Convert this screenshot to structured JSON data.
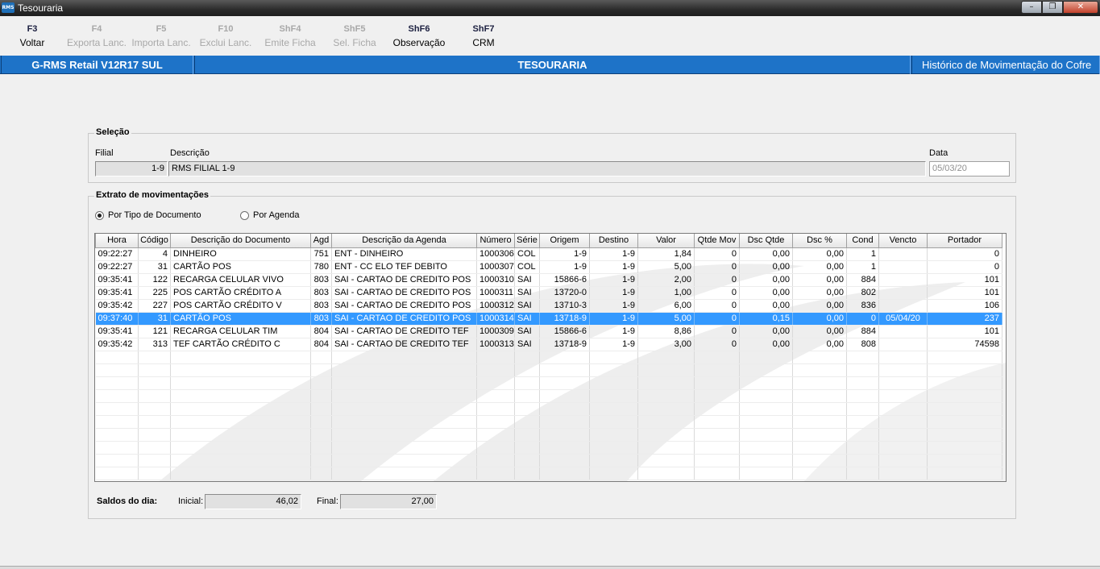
{
  "window": {
    "title": "Tesouraria",
    "app_icon": "RMS"
  },
  "toolbar": [
    {
      "key": "F3",
      "label": "Voltar",
      "enabled": true
    },
    {
      "key": "F4",
      "label": "Exporta Lanc.",
      "enabled": false
    },
    {
      "key": "F5",
      "label": "Importa Lanc.",
      "enabled": false
    },
    {
      "key": "F10",
      "label": "Exclui Lanc.",
      "enabled": false
    },
    {
      "key": "ShF4",
      "label": "Emite Ficha",
      "enabled": false
    },
    {
      "key": "ShF5",
      "label": "Sel. Ficha",
      "enabled": false
    },
    {
      "key": "ShF6",
      "label": "Observação",
      "enabled": true
    },
    {
      "key": "ShF7",
      "label": "CRM",
      "enabled": true
    }
  ],
  "header": {
    "system": "G-RMS Retail V12R17 SUL",
    "module": "TESOURARIA",
    "screen": "Histórico de Movimentação do Cofre"
  },
  "selecao": {
    "legend": "Seleção",
    "filial_label": "Filial",
    "filial_value": "1-9",
    "descricao_label": "Descrição",
    "descricao_value": "RMS FILIAL 1-9",
    "data_label": "Data",
    "data_value": "05/03/20"
  },
  "extrato": {
    "legend": "Extrato de movimentações",
    "radio_tipo": "Por Tipo de Documento",
    "radio_agenda": "Por Agenda",
    "selected_radio": "tipo",
    "columns": [
      "Hora",
      "Código",
      "Descrição do Documento",
      "Agd",
      "Descrição da Agenda",
      "Número",
      "Série",
      "Origem",
      "Destino",
      "Valor",
      "Qtde Mov",
      "Dsc Qtde",
      "Dsc %",
      "Cond",
      "Vencto",
      "Portador"
    ],
    "rows": [
      [
        "09:22:27",
        "4",
        "DINHEIRO",
        "751",
        "ENT - DINHEIRO",
        "1000306",
        "COL",
        "1-9",
        "1-9",
        "1,84",
        "0",
        "0,00",
        "0,00",
        "1",
        "",
        "0"
      ],
      [
        "09:22:27",
        "31",
        "CARTÃO POS",
        "780",
        "ENT - CC ELO TEF DEBITO",
        "1000307",
        "COL",
        "1-9",
        "1-9",
        "5,00",
        "0",
        "0,00",
        "0,00",
        "1",
        "",
        "0"
      ],
      [
        "09:35:41",
        "122",
        "RECARGA CELULAR VIVO",
        "803",
        "SAI - CARTAO DE CREDITO POS",
        "1000310",
        "SAI",
        "15866-6",
        "1-9",
        "2,00",
        "0",
        "0,00",
        "0,00",
        "884",
        "",
        "101"
      ],
      [
        "09:35:41",
        "225",
        "POS CARTÃO CRÉDITO A",
        "803",
        "SAI - CARTAO DE CREDITO POS",
        "1000311",
        "SAI",
        "13720-0",
        "1-9",
        "1,00",
        "0",
        "0,00",
        "0,00",
        "802",
        "",
        "101"
      ],
      [
        "09:35:42",
        "227",
        "POS CARTÃO CRÉDITO V",
        "803",
        "SAI - CARTAO DE CREDITO POS",
        "1000312",
        "SAI",
        "13710-3",
        "1-9",
        "6,00",
        "0",
        "0,00",
        "0,00",
        "836",
        "",
        "106"
      ],
      [
        "09:37:40",
        "31",
        "CARTÃO POS",
        "803",
        "SAI - CARTAO DE CREDITO POS",
        "1000314",
        "SAI",
        "13718-9",
        "1-9",
        "5,00",
        "0",
        "0,15",
        "0,00",
        "0",
        "05/04/20",
        "237"
      ],
      [
        "09:35:41",
        "121",
        "RECARGA CELULAR TIM",
        "804",
        "SAI - CARTAO DE CREDITO TEF",
        "1000309",
        "SAI",
        "15866-6",
        "1-9",
        "8,86",
        "0",
        "0,00",
        "0,00",
        "884",
        "",
        "101"
      ],
      [
        "09:35:42",
        "313",
        "TEF CARTÃO CRÉDITO C",
        "804",
        "SAI - CARTAO DE CREDITO TEF",
        "1000313",
        "SAI",
        "13718-9",
        "1-9",
        "3,00",
        "0",
        "0,00",
        "0,00",
        "808",
        "",
        "74598"
      ]
    ],
    "selected_row": 5
  },
  "saldos": {
    "label": "Saldos do dia:",
    "inicial_label": "Inicial:",
    "inicial_value": "46,02",
    "final_label": "Final:",
    "final_value": "27,00"
  },
  "colors": {
    "accent": "#1e73c8",
    "selection": "#3399ff",
    "disabled_text": "#a8a8a8"
  }
}
